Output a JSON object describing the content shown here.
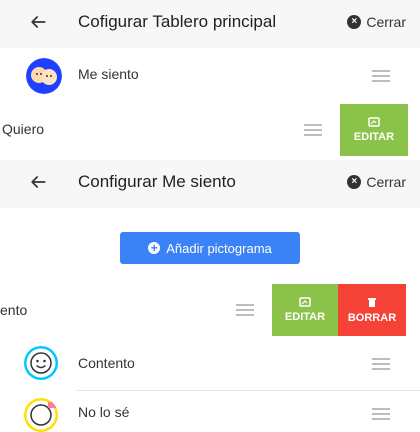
{
  "screen1": {
    "title": "Cofigurar Tablero principal",
    "close_label": "Cerrar",
    "items": [
      {
        "label": "Me siento"
      },
      {
        "label": "Quiero"
      }
    ],
    "edit_label": "EDITAR"
  },
  "screen2": {
    "title": "Configurar Me siento",
    "close_label": "Cerrar",
    "add_button_label": "Añadir pictograma",
    "swiped_item_label": "ento",
    "edit_label": "EDITAR",
    "delete_label": "BORRAR",
    "items": [
      {
        "label": "Contento"
      },
      {
        "label": "No lo sé"
      }
    ]
  },
  "colors": {
    "edit_bg": "#8bc34a",
    "delete_bg": "#f44336",
    "primary_button": "#3b82f6"
  },
  "icons": {
    "back": "arrow-left-icon",
    "close": "close-circle-icon",
    "drag": "drag-handle-icon",
    "edit": "edit-icon",
    "delete": "trash-icon",
    "add": "plus-circle-icon"
  }
}
